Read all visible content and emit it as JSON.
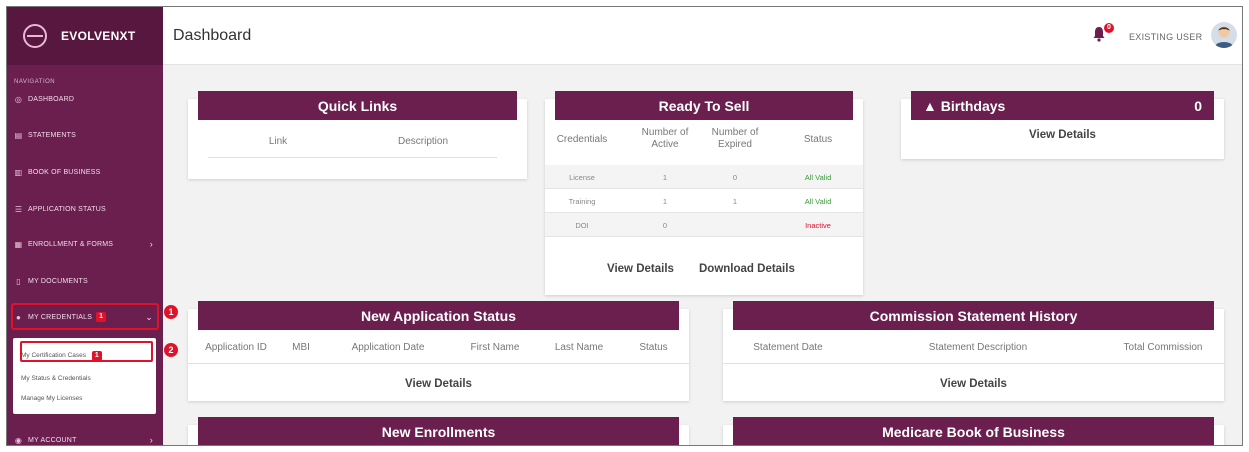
{
  "brand": {
    "name": "EVOLVENXT"
  },
  "sidebar": {
    "heading": "NAVIGATION",
    "items": [
      {
        "label": "DASHBOARD",
        "icon": "dashboard-icon"
      },
      {
        "label": "STATEMENTS",
        "icon": "statements-icon"
      },
      {
        "label": "BOOK OF BUSINESS",
        "icon": "book-of-business-icon"
      },
      {
        "label": "APPLICATION STATUS",
        "icon": "list-icon"
      },
      {
        "label": "ENROLLMENT & FORMS",
        "icon": "forms-icon"
      },
      {
        "label": "MY DOCUMENTS",
        "icon": "document-icon"
      },
      {
        "label": "MY CREDENTIALS",
        "badge": "1",
        "icon": "credentials-icon"
      },
      {
        "label": "MY ACCOUNT",
        "icon": "account-icon"
      }
    ],
    "submenu": [
      {
        "label": "My Certification Cases",
        "badge": "1"
      },
      {
        "label": "My Status & Credentials"
      },
      {
        "label": "Manage My Licenses"
      }
    ]
  },
  "annotations": [
    "1",
    "2"
  ],
  "header": {
    "title": "Dashboard",
    "notification_count": "0",
    "user": "EXISTING USER"
  },
  "quick_links": {
    "title": "Quick Links",
    "columns": [
      "Link",
      "Description"
    ]
  },
  "ready_to_sell": {
    "title": "Ready To Sell",
    "columns": [
      "Credentials",
      "Number of Active",
      "Number of Expired",
      "Status"
    ],
    "rows": [
      {
        "credential": "License",
        "active": "1",
        "expired": "0",
        "status": "All Valid"
      },
      {
        "credential": "Training",
        "active": "1",
        "expired": "1",
        "status": "All Valid"
      },
      {
        "credential": "DOI",
        "active": "0",
        "expired": "",
        "status": "Inactive"
      }
    ],
    "view_details": "View Details",
    "download_details": "Download Details"
  },
  "birthdays": {
    "title": "Birthdays",
    "count": "0",
    "view_details": "View Details"
  },
  "new_application_status": {
    "title": "New Application Status",
    "columns": [
      "Application ID",
      "MBI",
      "Application Date",
      "First Name",
      "Last Name",
      "Status"
    ],
    "view_details": "View Details"
  },
  "commission_history": {
    "title": "Commission Statement History",
    "columns": [
      "Statement Date",
      "Statement Description",
      "Total Commission"
    ],
    "view_details": "View Details"
  },
  "new_enrollments": {
    "title": "New Enrollments"
  },
  "medicare_book": {
    "title": "Medicare Book of Business"
  },
  "colors": {
    "brand": "#6a1f4f",
    "valid": "#3a9a3a",
    "inactive": "#e0122a",
    "badge": "#e0122a"
  }
}
